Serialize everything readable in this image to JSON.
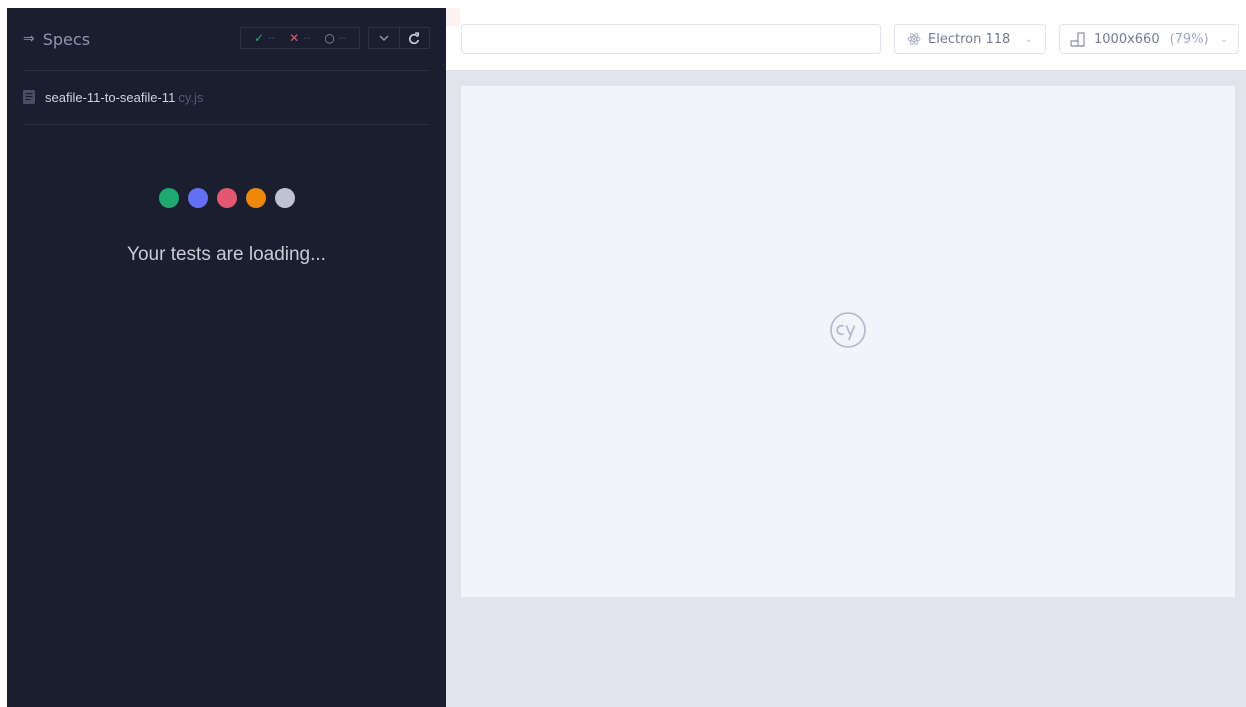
{
  "reporter": {
    "specs_label": "Specs",
    "stats": {
      "passed_glyph": "✓",
      "passed_count": "--",
      "failed_glyph": "✕",
      "failed_count": "--",
      "pending_glyph": "○",
      "pending_count": "--"
    },
    "spec_file": {
      "name": "seafile-11-to-seafile-11",
      "ext": "cy.js"
    },
    "loading_dots": [
      "#1fa971",
      "#6470f3",
      "#e45770",
      "#f0880a",
      "#c0c2d2"
    ],
    "loading_text": "Your tests are loading..."
  },
  "aut": {
    "url_value": "",
    "browser_label": "Electron 118",
    "viewport_label": "1000x660",
    "viewport_scale": "(79%)"
  },
  "icons": {
    "specs_toggle": "arrow-right-icon",
    "file": "document-icon",
    "dropdown": "chevron-down-icon",
    "reload": "reload-icon",
    "browser": "electron-icon",
    "viewport": "viewport-icon",
    "logo": "cypress-logo-icon"
  },
  "colors": {
    "reporter_bg": "#1b1e2e",
    "aut_bg": "#e1e3ed",
    "aut_frame": "#f3f4fa",
    "passed": "#1fa971",
    "failed": "#e45770"
  }
}
